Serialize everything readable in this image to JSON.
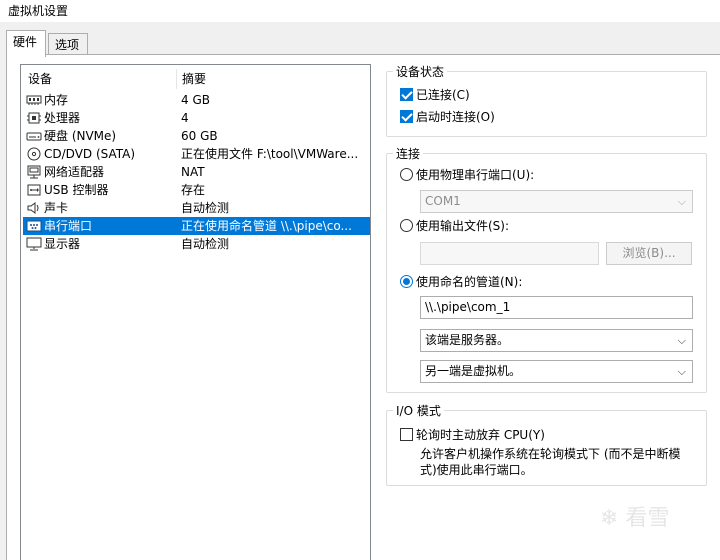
{
  "window": {
    "title": "虚拟机设置"
  },
  "tabs": [
    {
      "label": "硬件",
      "active": true
    },
    {
      "label": "选项",
      "active": false
    }
  ],
  "device_list": {
    "headers": {
      "device": "设备",
      "summary": "摘要"
    },
    "rows": [
      {
        "name": "内存",
        "summary": "4 GB",
        "icon": "memory-icon"
      },
      {
        "name": "处理器",
        "summary": "4",
        "icon": "cpu-icon"
      },
      {
        "name": "硬盘 (NVMe)",
        "summary": "60 GB",
        "icon": "harddisk-icon"
      },
      {
        "name": "CD/DVD (SATA)",
        "summary": "正在使用文件 F:\\tool\\VMWare...",
        "icon": "cd-icon"
      },
      {
        "name": "网络适配器",
        "summary": "NAT",
        "icon": "network-icon"
      },
      {
        "name": "USB 控制器",
        "summary": "存在",
        "icon": "usb-icon"
      },
      {
        "name": "声卡",
        "summary": "自动检测",
        "icon": "speaker-icon"
      },
      {
        "name": "串行端口",
        "summary": "正在使用命名管道 \\\\.\\pipe\\co...",
        "icon": "serial-port-icon",
        "selected": true
      },
      {
        "name": "显示器",
        "summary": "自动检测",
        "icon": "monitor-icon"
      }
    ]
  },
  "device_status": {
    "title": "设备状态",
    "connected": {
      "label": "已连接(C)",
      "checked": true
    },
    "connect_at_power_on": {
      "label": "启动时连接(O)",
      "checked": true
    }
  },
  "connection": {
    "title": "连接",
    "physical_port": {
      "label": "使用物理串行端口(U):",
      "selected": false,
      "value": "COM1"
    },
    "output_file": {
      "label": "使用输出文件(S):",
      "selected": false,
      "value": "",
      "browse_label": "浏览(B)..."
    },
    "named_pipe": {
      "label": "使用命名的管道(N):",
      "selected": true,
      "pipe_name": "\\\\.\\pipe\\com_1",
      "end_role": "该端是服务器。",
      "other_end": "另一端是虚拟机。"
    }
  },
  "io_mode": {
    "title": "I/O 模式",
    "yield_cpu": {
      "label": "轮询时主动放弃 CPU(Y)",
      "checked": false
    },
    "description_line1": "允许客户机操作系统在轮询模式下 (而不是中断模",
    "description_line2": "式)使用此串行端口。"
  },
  "watermark": {
    "text": "看雪"
  },
  "colors": {
    "selection": "#0078d7",
    "accent": "#0078d7",
    "window_bg": "#f0f0f0"
  }
}
